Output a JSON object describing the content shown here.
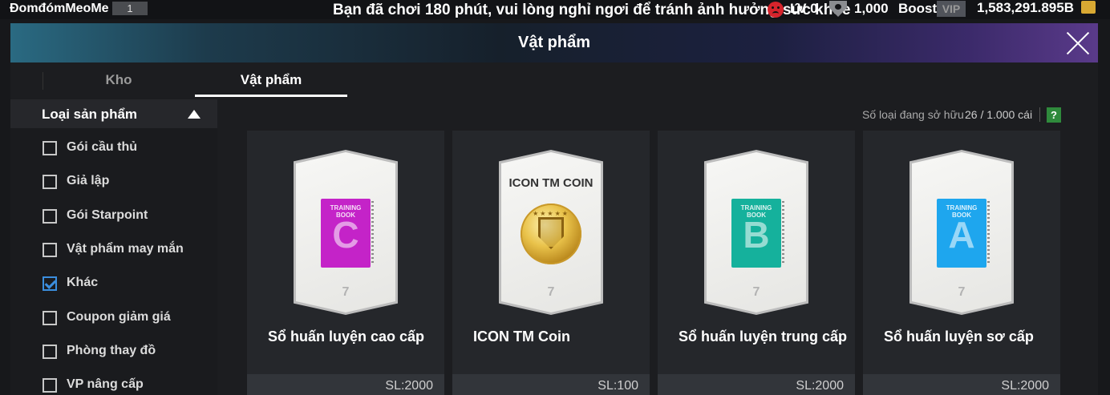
{
  "topbar": {
    "username": "ĐomđómMeoMe",
    "user_level": "1",
    "notice": "Bạn đã chơi 180 phút, vui lòng nghỉ ngơi để tránh ảnh hưởng sức khỏe",
    "lv_text": "LV 0",
    "coin_amount": "1,000",
    "boost_label": "Boost",
    "vip_label": "VIP",
    "money": "1,583,291.895B"
  },
  "title": "Vật phẩm",
  "tabs": [
    {
      "label": "Kho",
      "active": false
    },
    {
      "label": "Vật phẩm",
      "active": true
    }
  ],
  "sidebar": {
    "header": "Loại sản phẩm",
    "items": [
      {
        "label": "Gói cầu thủ",
        "checked": false
      },
      {
        "label": "Giả lập",
        "checked": false
      },
      {
        "label": "Gói Starpoint",
        "checked": false
      },
      {
        "label": "Vật phẩm may mắn",
        "checked": false
      },
      {
        "label": "Khác",
        "checked": true
      },
      {
        "label": "Coupon giảm giá",
        "checked": false
      },
      {
        "label": "Phòng thay đồ",
        "checked": false
      },
      {
        "label": "VP nâng cấp",
        "checked": false
      }
    ]
  },
  "owned": {
    "label": "Số loại đang sở hữu",
    "count": "26 / 1.000 cái",
    "help": "?"
  },
  "cards": [
    {
      "name": "Sổ huấn luyện cao cấp",
      "qty": "SL:2000",
      "type": "book",
      "book_head": "TRAINING BOOK",
      "letter": "C",
      "color": "#c423c8"
    },
    {
      "name": "ICON TM Coin",
      "qty": "SL:100",
      "type": "coin",
      "caption": "ICON TM COIN"
    },
    {
      "name": "Sổ huấn luyện trung cấp",
      "qty": "SL:2000",
      "type": "book",
      "book_head": "TRAINING BOOK",
      "letter": "B",
      "color": "#15b19c"
    },
    {
      "name": "Sổ huấn luyện sơ cấp",
      "qty": "SL:2000",
      "type": "book",
      "book_head": "TRAINING BOOK",
      "letter": "A",
      "color": "#1ea6ee"
    }
  ],
  "colors": {
    "accent_check": "#3b8ede",
    "help_green": "#2f8a3c"
  }
}
